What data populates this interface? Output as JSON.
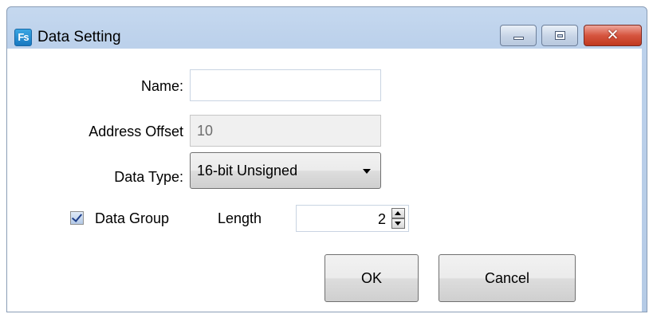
{
  "window": {
    "title": "Data Setting",
    "app_icon_text": "Fs",
    "close_glyph": "✕"
  },
  "form": {
    "name_label": "Name:",
    "name_value": "",
    "offset_label": "Address Offset",
    "offset_value": "10",
    "type_label": "Data Type:",
    "type_value": "16-bit Unsigned",
    "group_label": "Data Group",
    "group_checked": true,
    "length_label": "Length",
    "length_value": "2"
  },
  "buttons": {
    "ok": "OK",
    "cancel": "Cancel"
  },
  "icons": [
    "app-icon",
    "minimize-icon",
    "maximize-icon",
    "close-icon",
    "checkbox-icon",
    "chevron-down-icon",
    "spin-up-icon",
    "spin-down-icon"
  ],
  "colors": {
    "titlebar": "#c5d8ef",
    "close_button": "#c0391f",
    "accent": "#1778c0"
  }
}
